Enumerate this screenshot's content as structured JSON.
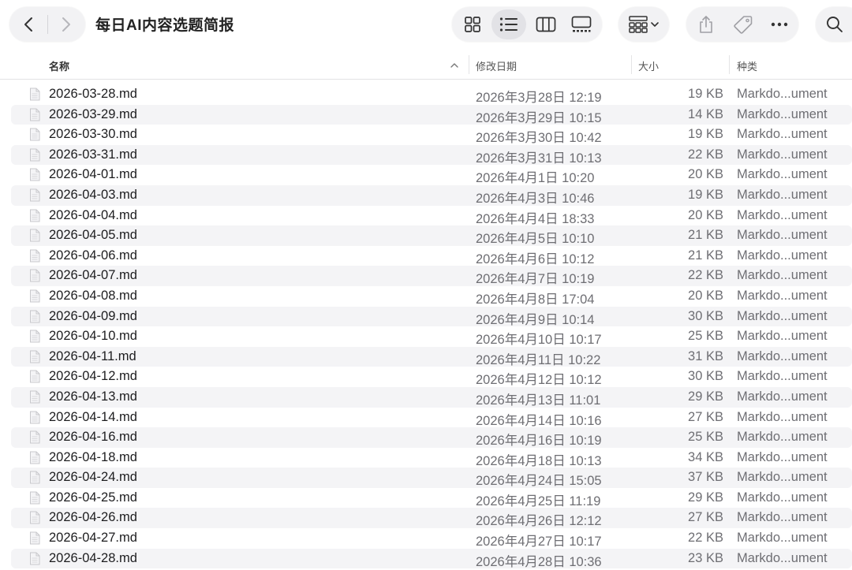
{
  "window": {
    "title": "每日AI内容选题简报"
  },
  "toolbar": {
    "icons": [
      "chevron-left-icon",
      "chevron-right-icon",
      "grid-view-icon",
      "list-view-icon",
      "column-view-icon",
      "gallery-view-icon",
      "group-icon",
      "share-icon",
      "tag-icon",
      "more-icon",
      "search-icon"
    ]
  },
  "columns": {
    "name": "名称",
    "date": "修改日期",
    "size": "大小",
    "kind": "种类"
  },
  "files": [
    {
      "name": "2026-03-28.md",
      "date": "2026年3月28日 12:19",
      "size": "19 KB",
      "kind": "Markdo...ument"
    },
    {
      "name": "2026-03-29.md",
      "date": "2026年3月29日 10:15",
      "size": "14 KB",
      "kind": "Markdo...ument"
    },
    {
      "name": "2026-03-30.md",
      "date": "2026年3月30日 10:42",
      "size": "19 KB",
      "kind": "Markdo...ument"
    },
    {
      "name": "2026-03-31.md",
      "date": "2026年3月31日 10:13",
      "size": "22 KB",
      "kind": "Markdo...ument"
    },
    {
      "name": "2026-04-01.md",
      "date": "2026年4月1日 10:20",
      "size": "20 KB",
      "kind": "Markdo...ument"
    },
    {
      "name": "2026-04-03.md",
      "date": "2026年4月3日 10:46",
      "size": "19 KB",
      "kind": "Markdo...ument"
    },
    {
      "name": "2026-04-04.md",
      "date": "2026年4月4日 18:33",
      "size": "20 KB",
      "kind": "Markdo...ument"
    },
    {
      "name": "2026-04-05.md",
      "date": "2026年4月5日 10:10",
      "size": "21 KB",
      "kind": "Markdo...ument"
    },
    {
      "name": "2026-04-06.md",
      "date": "2026年4月6日 10:12",
      "size": "21 KB",
      "kind": "Markdo...ument"
    },
    {
      "name": "2026-04-07.md",
      "date": "2026年4月7日 10:19",
      "size": "22 KB",
      "kind": "Markdo...ument"
    },
    {
      "name": "2026-04-08.md",
      "date": "2026年4月8日 17:04",
      "size": "20 KB",
      "kind": "Markdo...ument"
    },
    {
      "name": "2026-04-09.md",
      "date": "2026年4月9日 10:14",
      "size": "30 KB",
      "kind": "Markdo...ument"
    },
    {
      "name": "2026-04-10.md",
      "date": "2026年4月10日 10:17",
      "size": "25 KB",
      "kind": "Markdo...ument"
    },
    {
      "name": "2026-04-11.md",
      "date": "2026年4月11日 10:22",
      "size": "31 KB",
      "kind": "Markdo...ument"
    },
    {
      "name": "2026-04-12.md",
      "date": "2026年4月12日 10:12",
      "size": "30 KB",
      "kind": "Markdo...ument"
    },
    {
      "name": "2026-04-13.md",
      "date": "2026年4月13日 11:01",
      "size": "29 KB",
      "kind": "Markdo...ument"
    },
    {
      "name": "2026-04-14.md",
      "date": "2026年4月14日 10:16",
      "size": "27 KB",
      "kind": "Markdo...ument"
    },
    {
      "name": "2026-04-16.md",
      "date": "2026年4月16日 10:19",
      "size": "25 KB",
      "kind": "Markdo...ument"
    },
    {
      "name": "2026-04-18.md",
      "date": "2026年4月18日 10:13",
      "size": "34 KB",
      "kind": "Markdo...ument"
    },
    {
      "name": "2026-04-24.md",
      "date": "2026年4月24日 15:05",
      "size": "37 KB",
      "kind": "Markdo...ument"
    },
    {
      "name": "2026-04-25.md",
      "date": "2026年4月25日 11:19",
      "size": "29 KB",
      "kind": "Markdo...ument"
    },
    {
      "name": "2026-04-26.md",
      "date": "2026年4月26日 12:12",
      "size": "27 KB",
      "kind": "Markdo...ument"
    },
    {
      "name": "2026-04-27.md",
      "date": "2026年4月27日 10:17",
      "size": "22 KB",
      "kind": "Markdo...ument"
    },
    {
      "name": "2026-04-28.md",
      "date": "2026年4月28日 10:36",
      "size": "23 KB",
      "kind": "Markdo...ument"
    }
  ]
}
